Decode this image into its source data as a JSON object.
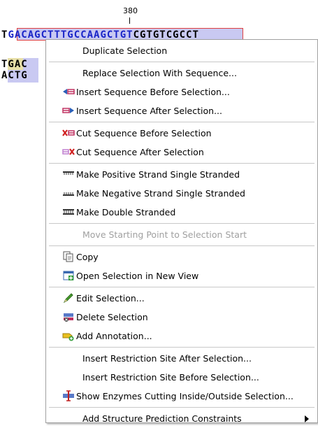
{
  "sequence": {
    "ruler_label": "380",
    "row1_left": "T",
    "row1_selected": "GACAGCTTTGCCAAGCTGT",
    "row1_right": "CGTGTCGCCT",
    "row2": "TGAC",
    "row3": "ACTG"
  },
  "menu": {
    "items": [
      {
        "label": "Duplicate Selection",
        "icon": ""
      },
      {
        "label": "Replace Selection With Sequence...",
        "icon": ""
      },
      {
        "label": "Insert Sequence Before Selection...",
        "icon": "insert-before-icon"
      },
      {
        "label": "Insert Sequence After Selection...",
        "icon": "insert-after-icon"
      },
      {
        "label": "Cut Sequence Before Selection",
        "icon": "cut-before-icon"
      },
      {
        "label": "Cut Sequence After Selection",
        "icon": "cut-after-icon"
      },
      {
        "label": "Make Positive Strand Single Stranded",
        "icon": "positive-strand-icon"
      },
      {
        "label": "Make Negative Strand Single Stranded",
        "icon": "negative-strand-icon"
      },
      {
        "label": "Make Double Stranded",
        "icon": "double-strand-icon"
      },
      {
        "label": "Move Starting Point to Selection Start",
        "icon": "",
        "disabled": true
      },
      {
        "label": "Copy",
        "icon": "copy-icon"
      },
      {
        "label": "Open Selection in New View",
        "icon": "new-view-icon"
      },
      {
        "label": "Edit Selection...",
        "icon": "pencil-icon"
      },
      {
        "label": "Delete Selection",
        "icon": "delete-icon"
      },
      {
        "label": "Add Annotation...",
        "icon": "add-annotation-icon"
      },
      {
        "label": "Insert Restriction Site After Selection...",
        "icon": ""
      },
      {
        "label": "Insert Restriction Site Before Selection...",
        "icon": ""
      },
      {
        "label": "Show Enzymes Cutting Inside/Outside Selection...",
        "icon": "enzymes-icon"
      },
      {
        "label": "Add Structure Prediction Constraints",
        "icon": "",
        "submenu": true
      }
    ]
  }
}
